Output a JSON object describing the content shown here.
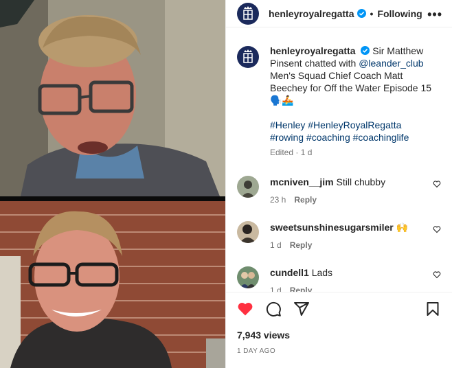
{
  "post": {
    "username": "henleyroyalregatta",
    "follow_label": "Following",
    "more_label": "•••",
    "separator": "•",
    "caption_text_1": "Sir Matthew Pinsent chatted with",
    "mention": "@leander_club",
    "caption_text_2": "Men's Squad Chief Coach Matt Beechey for Off the Water Episode 15 🗣️🚣",
    "hashtags": "#Henley #HenleyRoyalRegatta #rowing #coaching #coachinglife",
    "edited_meta": "Edited · 1 d"
  },
  "comments": [
    {
      "username": "mcniven__jim",
      "text": "Still chubby",
      "time": "23 h",
      "reply": "Reply"
    },
    {
      "username": "sweetsunshinesugarsmiler",
      "text": "🙌",
      "time": "1 d",
      "reply": "Reply"
    },
    {
      "username": "cundell1",
      "text": "Lads",
      "time": "1 d",
      "reply": "Reply"
    }
  ],
  "footer": {
    "views": "7,943 views",
    "time_ago": "1 DAY AGO"
  },
  "colors": {
    "like_red": "#ff3040",
    "link_blue": "#00376b",
    "verified_blue": "#0095f6",
    "brand_navy": "#1b2a5c"
  }
}
